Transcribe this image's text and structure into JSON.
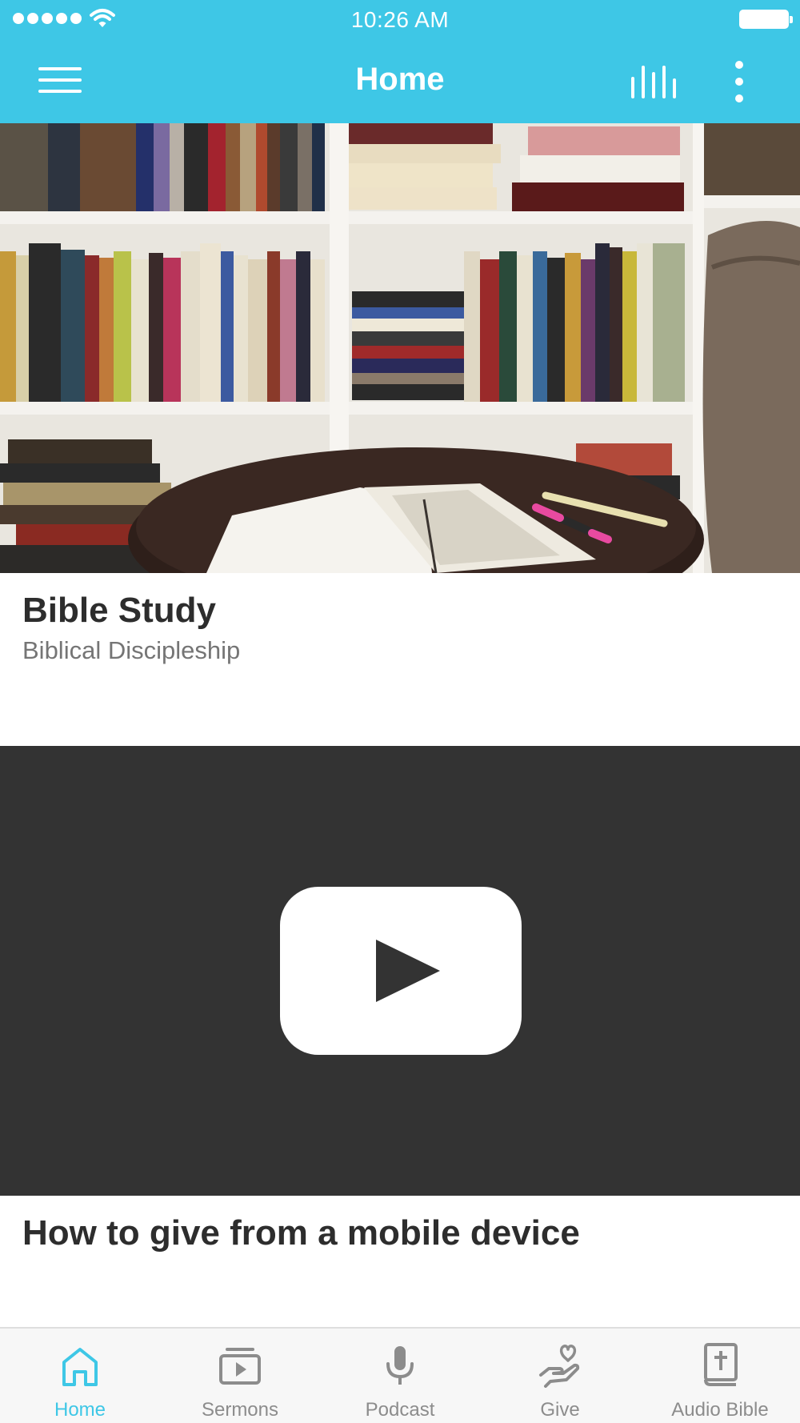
{
  "status_bar": {
    "time": "10:26 AM"
  },
  "nav": {
    "title": "Home"
  },
  "cards": [
    {
      "title": "Bible Study",
      "subtitle": "Biblical Discipleship"
    },
    {
      "title": "How to give from a mobile device"
    }
  ],
  "tabs": [
    {
      "label": "Home",
      "icon": "home-icon",
      "active": true
    },
    {
      "label": "Sermons",
      "icon": "video-library-icon",
      "active": false
    },
    {
      "label": "Podcast",
      "icon": "microphone-icon",
      "active": false
    },
    {
      "label": "Give",
      "icon": "give-heart-hand-icon",
      "active": false
    },
    {
      "label": "Audio Bible",
      "icon": "bible-icon",
      "active": false
    }
  ],
  "colors": {
    "accent": "#3ec7e6",
    "video_bg": "#333333",
    "tab_inactive": "#8c8c8c"
  }
}
